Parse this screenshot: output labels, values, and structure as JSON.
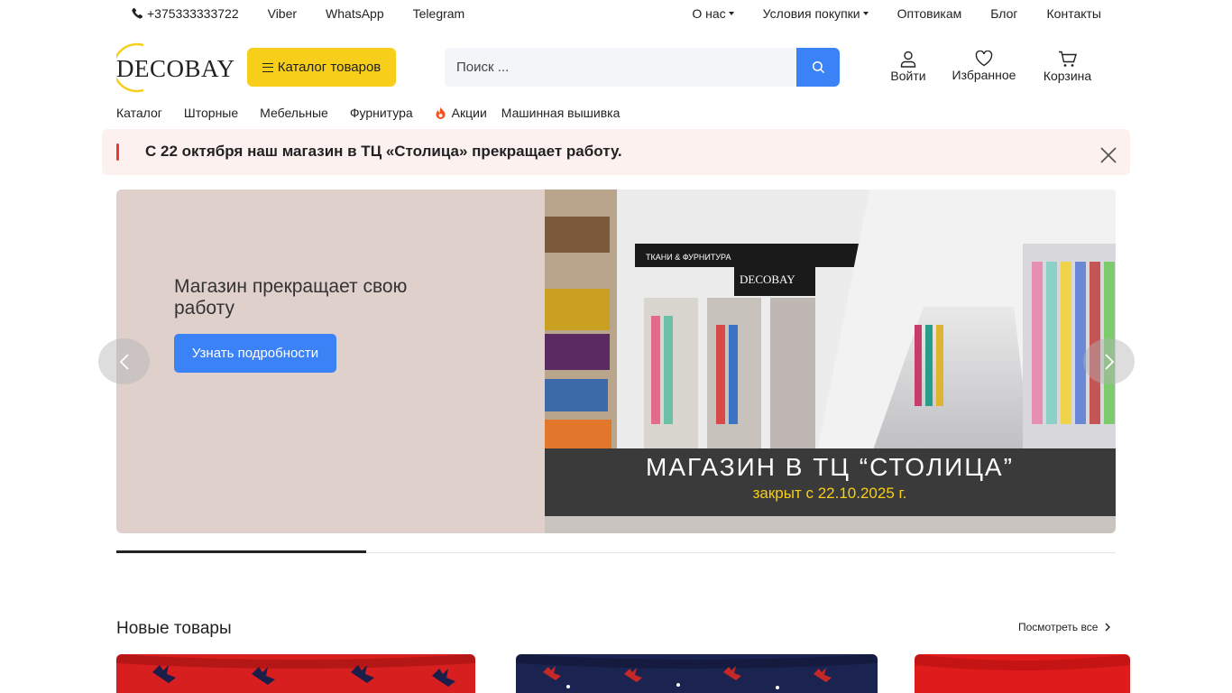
{
  "topbar": {
    "phone": "+375333333722",
    "messengers": [
      "Viber",
      "WhatsApp",
      "Telegram"
    ],
    "links": [
      {
        "label": "О нас",
        "dropdown": true
      },
      {
        "label": "Условия покупки",
        "dropdown": true
      },
      {
        "label": "Оптовикам",
        "dropdown": false
      },
      {
        "label": "Блог",
        "dropdown": false
      },
      {
        "label": "Контакты",
        "dropdown": false
      }
    ]
  },
  "header": {
    "logo_text": "DECOBAY",
    "catalog_button": "Каталог товаров",
    "search_placeholder": "Поиск ...",
    "actions": {
      "login": "Войти",
      "favorites": "Избранное",
      "cart": "Корзина"
    }
  },
  "mainnav": [
    "Каталог",
    "Шторные",
    "Мебельные",
    "Фурнитура",
    "Акции",
    "Машинная вышивка"
  ],
  "alert": {
    "text": "С 22 октября наш магазин в ТЦ «Столица» прекращает работу."
  },
  "hero": {
    "title": "Магазин прекращает свою работу",
    "button": "Узнать подробности",
    "photo_caption": "МАГАЗИН В ТЦ “СТОЛИЦА”",
    "photo_subcaption": "закрыт с 22.10.2025 г.",
    "storefront_sign": "ТКАНИ & ФУРНИТУРА",
    "storefront_logo": "DECOBAY",
    "slider_progress": 0.25
  },
  "new_products": {
    "title": "Новые товары",
    "view_all": "Посмотреть все"
  },
  "colors": {
    "accent_yellow": "#f7ce1a",
    "accent_blue": "#3b82f6",
    "alert_red": "#e53935",
    "alert_bg": "#fdf1f0",
    "hero_bg": "#dfd0cc"
  }
}
